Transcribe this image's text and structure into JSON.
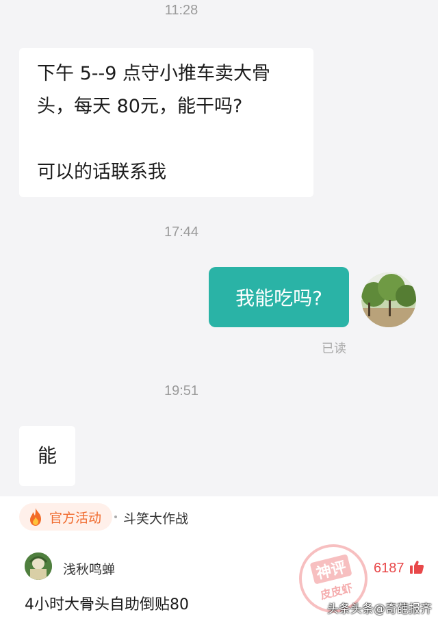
{
  "chat": {
    "messages": [
      {
        "time": "11:28"
      },
      {
        "direction": "in",
        "lines": [
          "下午 5--9 点守小推车卖大骨",
          "头，每天 80元，能干吗?",
          "",
          "可以的话联系我"
        ]
      },
      {
        "time": "17:44"
      },
      {
        "direction": "out",
        "text": "我能吃吗?",
        "status": "已读"
      },
      {
        "time": "19:51"
      },
      {
        "direction": "in",
        "text": "能"
      }
    ],
    "accent_color": "#2ab3a6"
  },
  "activity": {
    "icon": "flame-icon",
    "label": "官方活动",
    "title": "斗笑大作战"
  },
  "comment": {
    "username": "浅秋鸣蝉",
    "likes": "6187",
    "text": "4小时大骨头自助倒贴80",
    "stamp_line1": "神评",
    "stamp_line2": "皮皮虾"
  },
  "watermark": "头条头条@奇葩报齐"
}
